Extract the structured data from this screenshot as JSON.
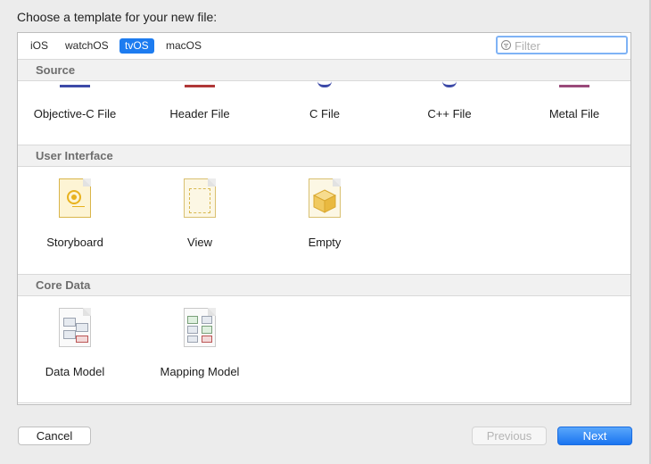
{
  "dialog": {
    "title": "Choose a template for your new file:"
  },
  "platform_tabs": [
    {
      "label": "iOS",
      "selected": false
    },
    {
      "label": "watchOS",
      "selected": false
    },
    {
      "label": "tvOS",
      "selected": true
    },
    {
      "label": "macOS",
      "selected": false
    }
  ],
  "filter": {
    "placeholder": "Filter",
    "value": ""
  },
  "sections": {
    "source": {
      "title": "Source",
      "items": [
        "Objective-C File",
        "Header File",
        "C File",
        "C++ File",
        "Metal File"
      ]
    },
    "user_interface": {
      "title": "User Interface",
      "items": [
        "Storyboard",
        "View",
        "Empty"
      ]
    },
    "core_data": {
      "title": "Core Data",
      "items": [
        "Data Model",
        "Mapping Model"
      ]
    }
  },
  "buttons": {
    "cancel": "Cancel",
    "previous": "Previous",
    "next": "Next"
  },
  "colors": {
    "accent": "#1d7cf0",
    "storyboard": "#f0c240",
    "empty_cube": "#f3d27a"
  }
}
